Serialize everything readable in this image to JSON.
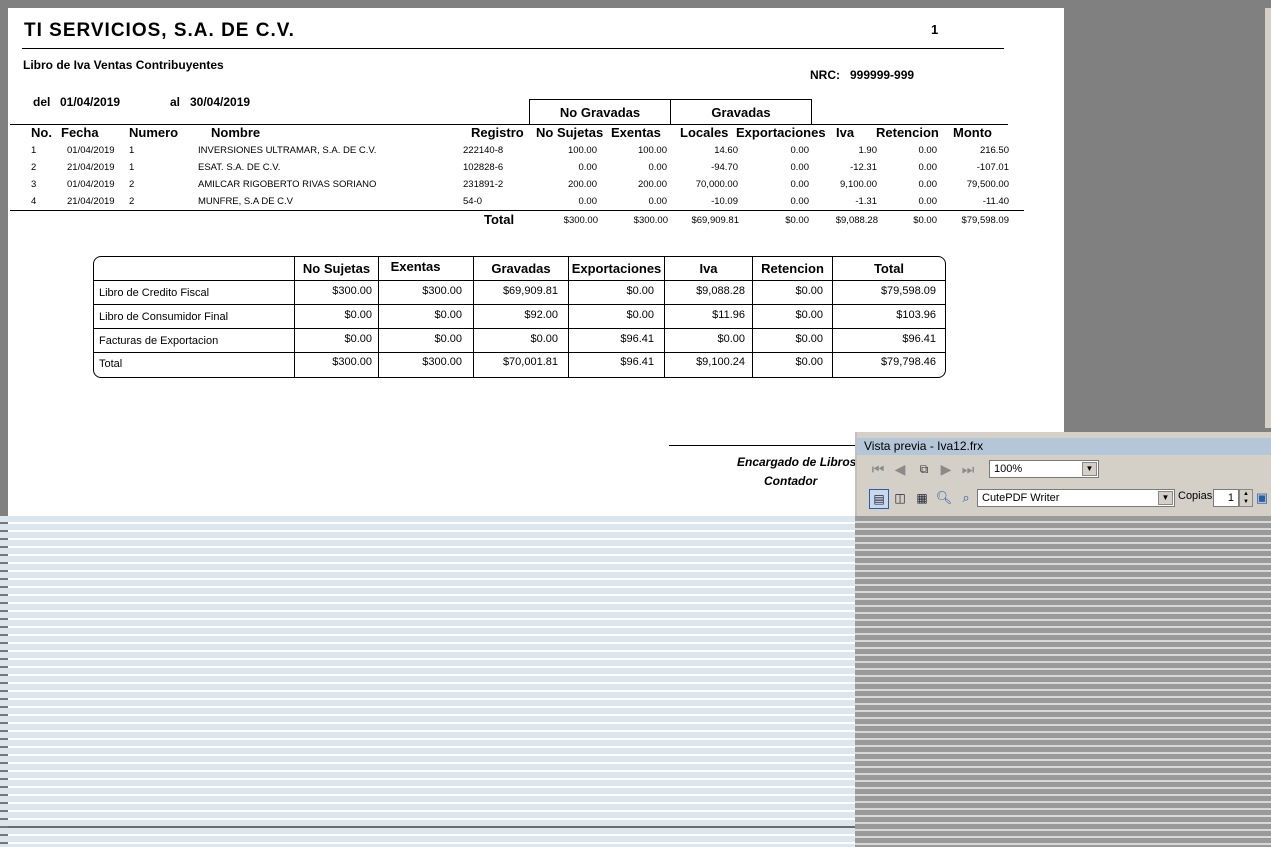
{
  "report": {
    "company": "TI SERVICIOS, S.A. DE C.V.",
    "page_number": "1",
    "subtitle": "Libro de Iva Ventas Contribuyentes",
    "nrc_label": "NRC:",
    "nrc_value": "999999-999",
    "from_label": "del",
    "from_date": "01/04/2019",
    "to_label": "al",
    "to_date": "30/04/2019",
    "group_no_gravadas": "No Gravadas",
    "group_gravadas": "Gravadas",
    "columns": [
      "No.",
      "Fecha",
      "Numero",
      "Nombre",
      "Registro",
      "No Sujetas",
      "Exentas",
      "Locales",
      "Exportaciones",
      "Iva",
      "Retencion",
      "Monto"
    ],
    "rows": [
      {
        "no": "1",
        "fecha": "01/04/2019",
        "numero": "1",
        "nombre": "INVERSIONES ULTRAMAR, S.A. DE C.V.",
        "registro": "222140-8",
        "no_sujetas": "100.00",
        "exentas": "100.00",
        "locales": "14.60",
        "exportaciones": "0.00",
        "iva": "1.90",
        "retencion": "0.00",
        "monto": "216.50"
      },
      {
        "no": "2",
        "fecha": "21/04/2019",
        "numero": "1",
        "nombre": "ESAT. S.A. DE C.V.",
        "registro": "102828-6",
        "no_sujetas": "0.00",
        "exentas": "0.00",
        "locales": "-94.70",
        "exportaciones": "0.00",
        "iva": "-12.31",
        "retencion": "0.00",
        "monto": "-107.01"
      },
      {
        "no": "3",
        "fecha": "01/04/2019",
        "numero": "2",
        "nombre": "AMILCAR RIGOBERTO RIVAS SORIANO",
        "registro": "231891-2",
        "no_sujetas": "200.00",
        "exentas": "200.00",
        "locales": "70,000.00",
        "exportaciones": "0.00",
        "iva": "9,100.00",
        "retencion": "0.00",
        "monto": "79,500.00"
      },
      {
        "no": "4",
        "fecha": "21/04/2019",
        "numero": "2",
        "nombre": "MUNFRE, S.A DE C.V",
        "registro": "54-0",
        "no_sujetas": "0.00",
        "exentas": "0.00",
        "locales": "-10.09",
        "exportaciones": "0.00",
        "iva": "-1.31",
        "retencion": "0.00",
        "monto": "-11.40"
      }
    ],
    "total_label": "Total",
    "totals": {
      "no_sujetas": "$300.00",
      "exentas": "$300.00",
      "locales": "$69,909.81",
      "exportaciones": "$0.00",
      "iva": "$9,088.28",
      "retencion": "$0.00",
      "monto": "$79,598.09"
    },
    "summary": {
      "headers": [
        "No Sujetas",
        "Exentas",
        "Gravadas",
        "Exportaciones",
        "Iva",
        "Retencion",
        "Total"
      ],
      "rows": [
        {
          "label": "Libro de Credito Fiscal",
          "values": [
            "$300.00",
            "$300.00",
            "$69,909.81",
            "$0.00",
            "$9,088.28",
            "$0.00",
            "$79,598.09"
          ]
        },
        {
          "label": "Libro de Consumidor Final",
          "values": [
            "$0.00",
            "$0.00",
            "$92.00",
            "$0.00",
            "$11.96",
            "$0.00",
            "$103.96"
          ]
        },
        {
          "label": "Facturas de Exportacion",
          "values": [
            "$0.00",
            "$0.00",
            "$0.00",
            "$96.41",
            "$0.00",
            "$0.00",
            "$96.41"
          ]
        },
        {
          "label": "Total",
          "values": [
            "$300.00",
            "$300.00",
            "$70,001.81",
            "$96.41",
            "$9,100.24",
            "$0.00",
            "$79,798.46"
          ]
        }
      ]
    },
    "signature_line1": "Encargado de Libros",
    "signature_line2": "Contador"
  },
  "preview": {
    "title": "Vista previa - Iva12.frx",
    "zoom": "100%",
    "printer": "CutePDF Writer",
    "copies_label": "Copias",
    "copies_value": "1",
    "icons": [
      "first-page-icon",
      "prev-page-icon",
      "goto-page-icon",
      "next-page-icon",
      "last-page-icon",
      "one-page-icon",
      "two-pages-icon",
      "four-pages-icon",
      "zoom-icon",
      "zoom-fit-icon",
      "save-icon"
    ]
  }
}
